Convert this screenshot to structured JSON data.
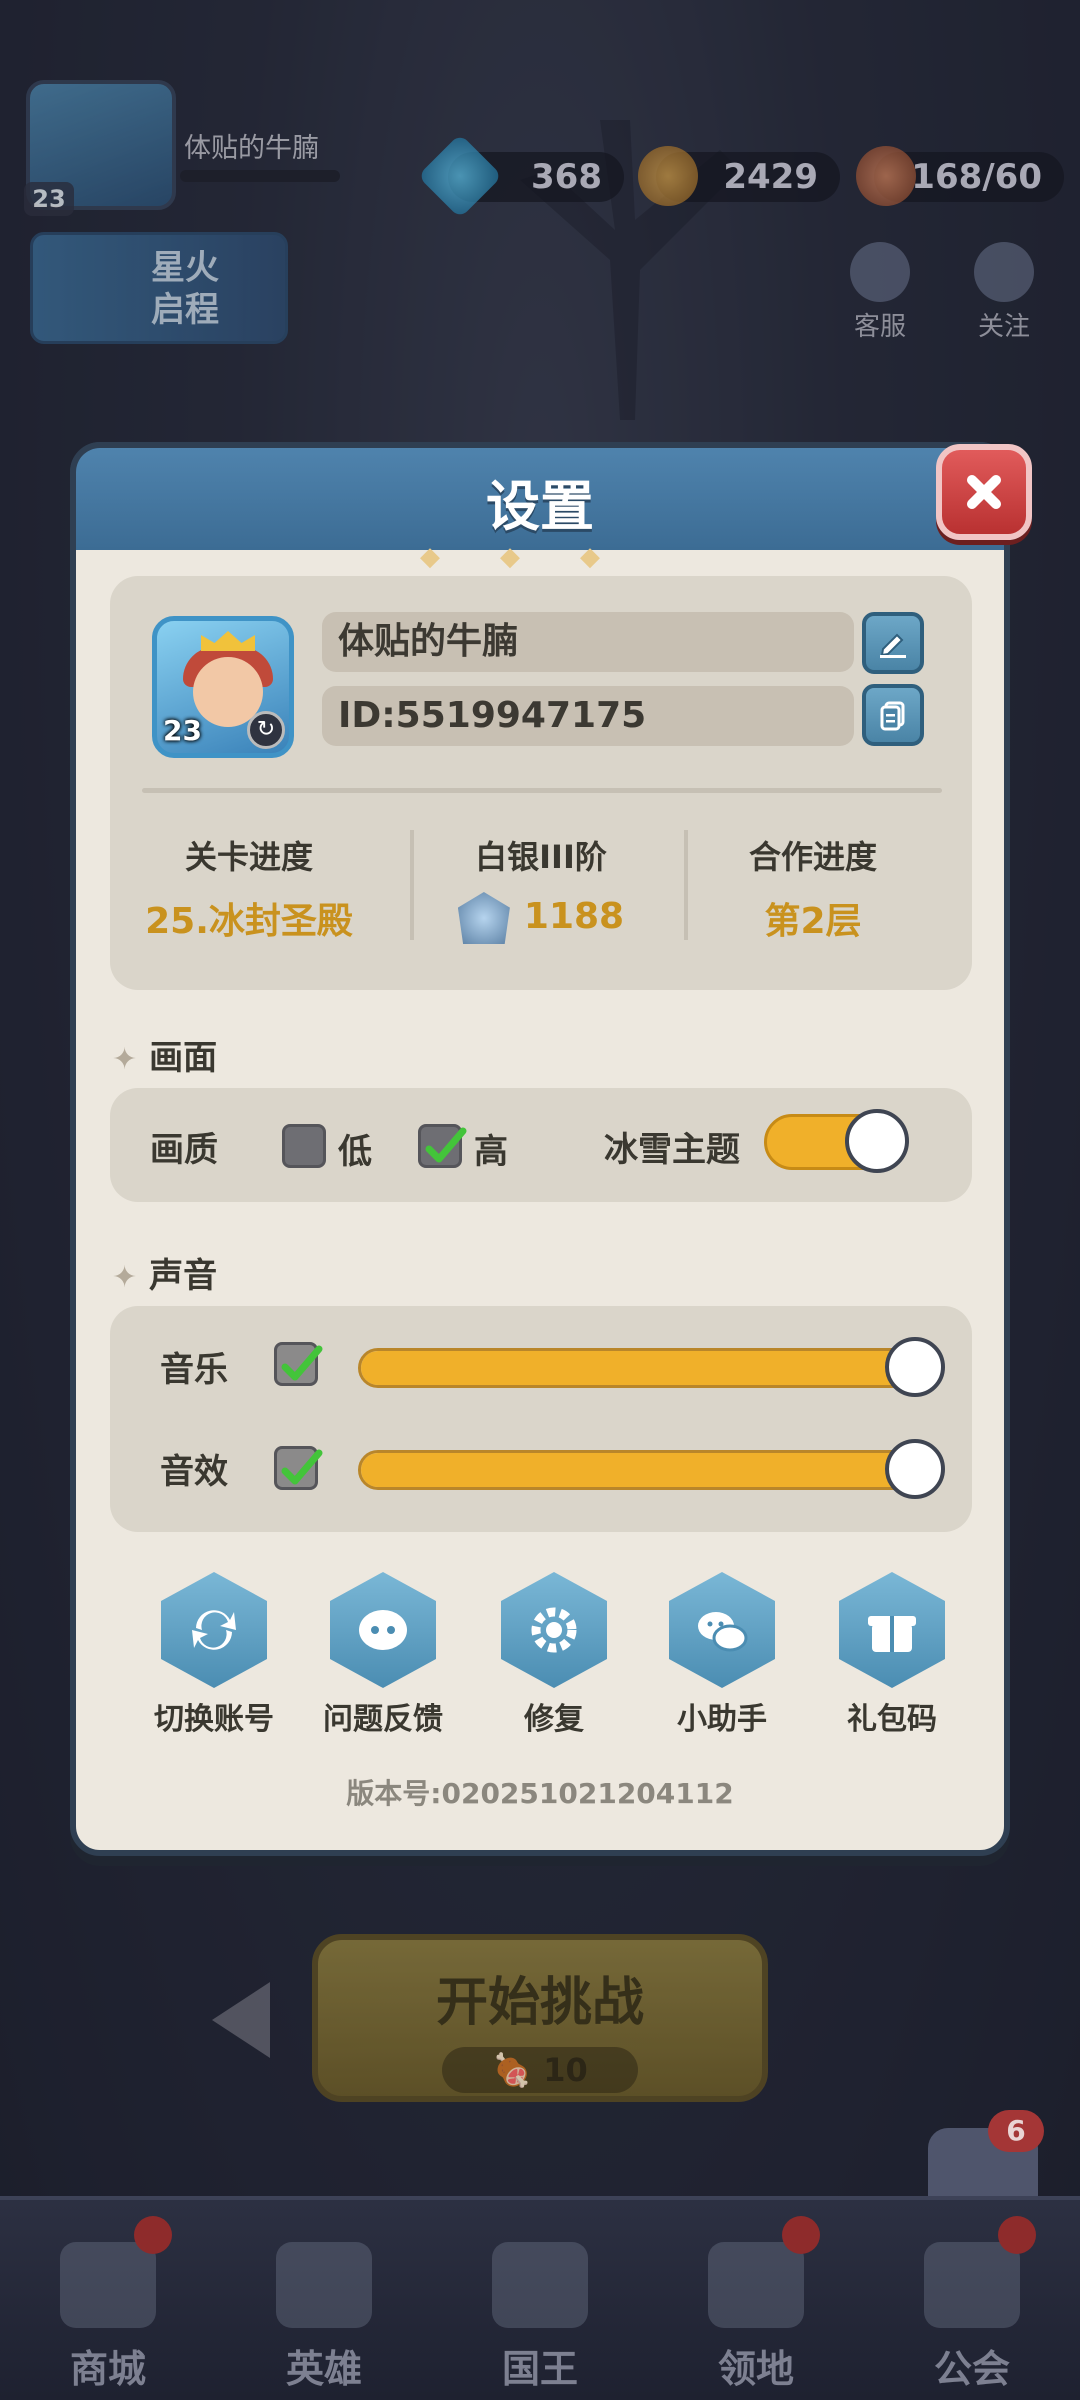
{
  "hud": {
    "player_name": "体贴的牛腩",
    "player_level": "23",
    "gems": "368",
    "gold": "2429",
    "stamina": "168/60",
    "event_banner": "星火\n启程",
    "customer_service_label": "客服",
    "follow_label": "关注"
  },
  "modal": {
    "title": "设置",
    "profile": {
      "name": "体贴的牛腩",
      "id": "ID:5519947175",
      "avatar_level": "23",
      "stats": [
        {
          "label": "关卡进度",
          "value": "25.冰封圣殿"
        },
        {
          "label": "白银III阶",
          "value": "1188"
        },
        {
          "label": "合作进度",
          "value": "第2层"
        }
      ]
    },
    "graphics": {
      "section_title": "画面",
      "quality_label": "画质",
      "low_label": "低",
      "low_checked": false,
      "high_label": "高",
      "high_checked": true,
      "theme_label": "冰雪主题",
      "theme_on": true
    },
    "sound": {
      "section_title": "声音",
      "music_label": "音乐",
      "music_enabled": true,
      "music_level": 1.0,
      "sfx_label": "音效",
      "sfx_enabled": true,
      "sfx_level": 1.0
    },
    "actions": [
      {
        "label": "切换账号",
        "icon": "switch-account-icon"
      },
      {
        "label": "问题反馈",
        "icon": "feedback-icon"
      },
      {
        "label": "修复",
        "icon": "repair-gear-icon"
      },
      {
        "label": "小助手",
        "icon": "wechat-icon"
      },
      {
        "label": "礼包码",
        "icon": "gift-icon"
      }
    ],
    "version": "版本号:020251021204112"
  },
  "bottom": {
    "start_label": "开始挑战",
    "start_cost": "10",
    "coop_badge": "6",
    "nav": [
      "商城",
      "英雄",
      "国王",
      "领地",
      "公会"
    ]
  },
  "colors": {
    "accent_gold": "#c9921e",
    "toggle_on": "#f0b02a",
    "header_blue": "#4f83ad",
    "close_red": "#c93d3d"
  }
}
